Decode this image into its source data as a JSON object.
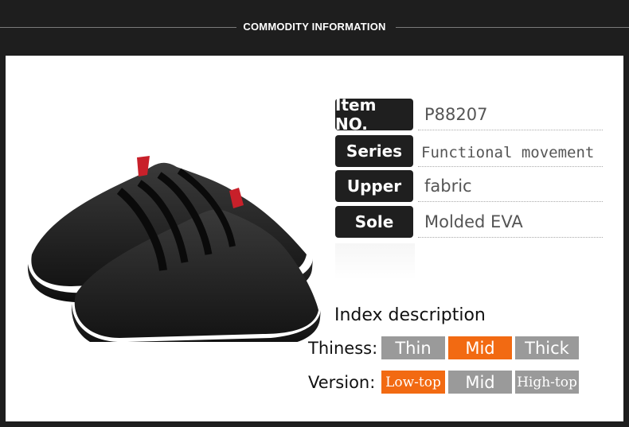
{
  "header": {
    "title": "COMMODITY INFORMATION"
  },
  "specs": [
    {
      "label": "Item NO.",
      "value": "P88207"
    },
    {
      "label": "Series",
      "value": "Functional movement"
    },
    {
      "label": "Upper",
      "value": "fabric"
    },
    {
      "label": "Sole",
      "value": "Molded EVA"
    }
  ],
  "index": {
    "title": "Index description",
    "thickness": {
      "label": "Thiness:",
      "options": [
        "Thin",
        "Mid",
        "Thick"
      ],
      "selected": "Mid"
    },
    "version": {
      "label": "Version:",
      "options": [
        "Low-top",
        "Mid",
        "High-top"
      ],
      "selected": "Low-top"
    }
  },
  "colors": {
    "accent": "#f26a12",
    "inactive": "#9a9a9a",
    "label_bg": "#1f1f1f"
  }
}
